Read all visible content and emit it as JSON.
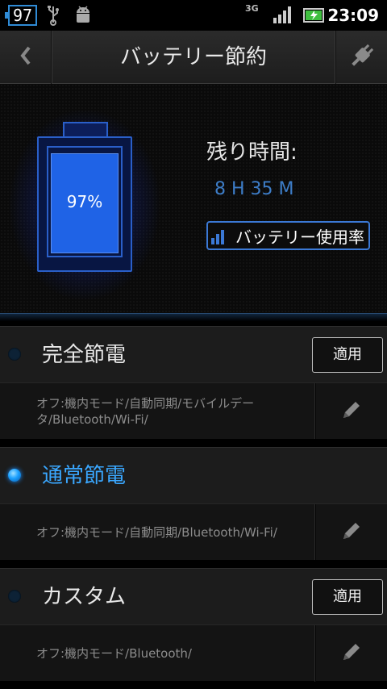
{
  "status_bar": {
    "battery_badge": "97",
    "network": "3G",
    "time": "23:09",
    "icons": [
      "usb-icon",
      "android-icon",
      "signal-icon",
      "charging-battery-icon"
    ]
  },
  "header": {
    "title": "バッテリー節約",
    "back_icon": "chevron-left-icon",
    "plug_icon": "plug-icon"
  },
  "battery": {
    "percent_label": "97%",
    "level_fraction": 0.97,
    "remaining_label": "残り時間:",
    "remaining_value": "8 H 35 M",
    "usage_button_label": "バッテリー使用率"
  },
  "modes": [
    {
      "title": "完全節電",
      "selected": false,
      "apply_label": "適用",
      "description": "オフ:機内モード/自動同期/モバイルデータ/Bluetooth/Wi-Fi/"
    },
    {
      "title": "通常節電",
      "selected": true,
      "apply_label": "",
      "description": "オフ:機内モード/自動同期/Bluetooth/Wi-Fi/"
    },
    {
      "title": "カスタム",
      "selected": false,
      "apply_label": "適用",
      "description": "オフ:機内モード/Bluetooth/"
    }
  ],
  "colors": {
    "accent": "#3aa7ff",
    "battery_fill": "#1f63e6",
    "remaining_value": "#3d7dc8"
  }
}
